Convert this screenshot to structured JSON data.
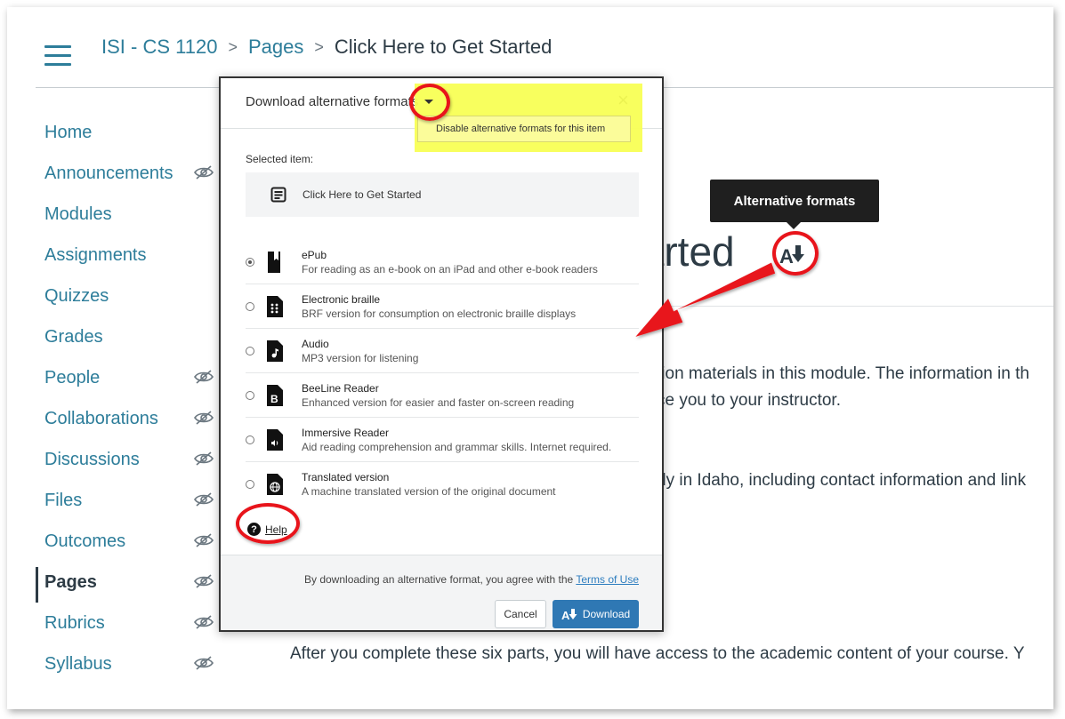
{
  "breadcrumb": {
    "course": "ISI - CS 1120",
    "section": "Pages",
    "current": "Click Here to Get Started",
    "separator": ">"
  },
  "sidebar": {
    "items": [
      {
        "label": "Home",
        "hidden": false
      },
      {
        "label": "Announcements",
        "hidden": true
      },
      {
        "label": "Modules",
        "hidden": false
      },
      {
        "label": "Assignments",
        "hidden": false
      },
      {
        "label": "Quizzes",
        "hidden": false
      },
      {
        "label": "Grades",
        "hidden": false
      },
      {
        "label": "People",
        "hidden": true
      },
      {
        "label": "Collaborations",
        "hidden": true
      },
      {
        "label": "Discussions",
        "hidden": true
      },
      {
        "label": "Files",
        "hidden": true
      },
      {
        "label": "Outcomes",
        "hidden": true
      },
      {
        "label": "Pages",
        "hidden": true,
        "active": true
      },
      {
        "label": "Rubrics",
        "hidden": true
      },
      {
        "label": "Syllabus",
        "hidden": true
      }
    ]
  },
  "page": {
    "title_fragment": "tarted",
    "text_1": "tion materials in this module. The information in th",
    "text_2": "ce you to your instructor.",
    "text_3": "dy in Idaho, including contact information and link",
    "text_4": "After you complete these six parts, you will have access to the academic content of your course. Y"
  },
  "tooltip": {
    "label": "Alternative formats"
  },
  "dialog": {
    "title": "Download alternative formats",
    "close_symbol": "×",
    "menu_option": "Disable alternative formats for this item",
    "selected_label": "Selected item:",
    "selected_item": "Click Here to Get Started",
    "options": [
      {
        "name": "ePub",
        "desc": "For reading as an e-book on an iPad and other e-book readers",
        "icon": "book-icon",
        "checked": true
      },
      {
        "name": "Electronic braille",
        "desc": "BRF version for consumption on electronic braille displays",
        "icon": "braille-icon",
        "checked": false
      },
      {
        "name": "Audio",
        "desc": "MP3 version for listening",
        "icon": "audio-icon",
        "checked": false
      },
      {
        "name": "BeeLine Reader",
        "desc": "Enhanced version for easier and faster on-screen reading",
        "icon": "beeline-icon",
        "checked": false
      },
      {
        "name": "Immersive Reader",
        "desc": "Aid reading comprehension and grammar skills. Internet required.",
        "icon": "immersive-icon",
        "checked": false
      },
      {
        "name": "Translated version",
        "desc": "A machine translated version of the original document",
        "icon": "globe-icon",
        "checked": false
      }
    ],
    "help_label": "Help",
    "terms_prefix": "By downloading an alternative format, you agree with the",
    "terms_link": "Terms of Use",
    "cancel_label": "Cancel",
    "download_label": "Download"
  },
  "colors": {
    "link": "#2d7d9a",
    "primary_button": "#2f78b4",
    "annotation_red": "#e8141b",
    "highlight_yellow": "#f8ff55"
  }
}
